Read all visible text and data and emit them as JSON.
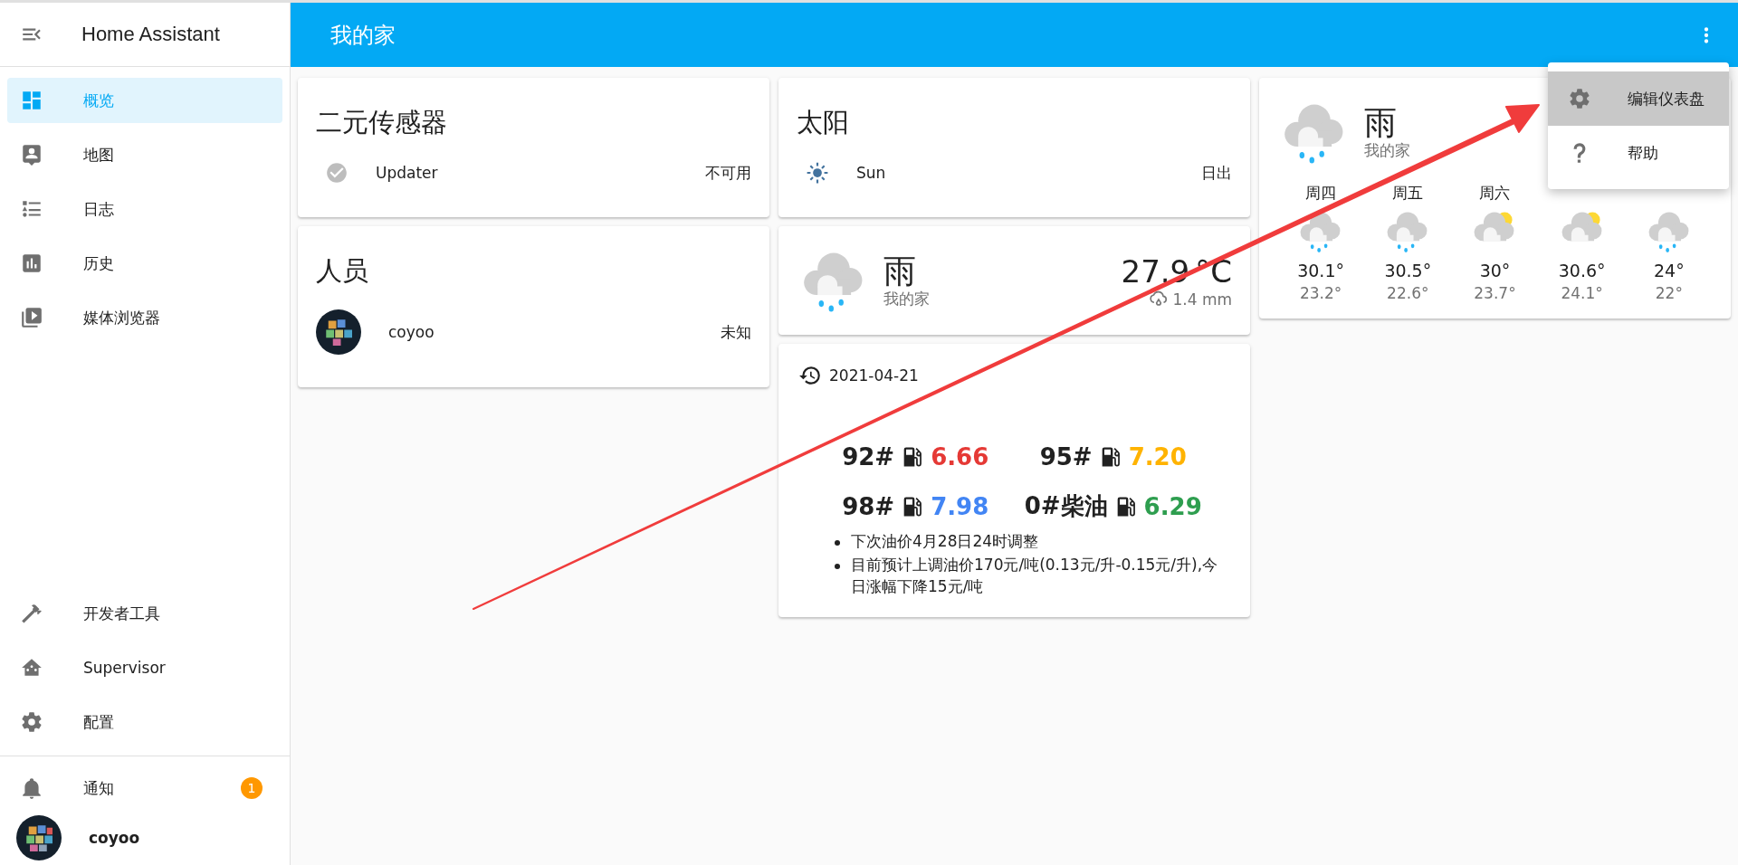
{
  "sidebar": {
    "title": "Home Assistant",
    "items": [
      {
        "label": "概览",
        "selected": true
      },
      {
        "label": "地图",
        "selected": false
      },
      {
        "label": "日志",
        "selected": false
      },
      {
        "label": "历史",
        "selected": false
      },
      {
        "label": "媒体浏览器",
        "selected": false
      }
    ],
    "bottom_items": [
      {
        "label": "开发者工具",
        "selected": false
      },
      {
        "label": "Supervisor",
        "selected": false
      },
      {
        "label": "配置",
        "selected": false
      }
    ],
    "notifications": {
      "label": "通知",
      "count": "1"
    },
    "user": {
      "name": "coyoo"
    }
  },
  "header": {
    "title": "我的家"
  },
  "menu": {
    "items": [
      {
        "label": "编辑仪表盘",
        "selected": true
      },
      {
        "label": "帮助",
        "selected": false
      }
    ]
  },
  "columns": [
    [
      {
        "kind": "entities",
        "title": "二元传感器",
        "rows": [
          {
            "name": "Updater",
            "state": "不可用"
          }
        ]
      },
      {
        "kind": "person",
        "title": "人员",
        "rows": [
          {
            "name": "coyoo",
            "state": "未知"
          }
        ]
      }
    ],
    [
      {
        "kind": "sun",
        "title": "太阳",
        "rows": [
          {
            "name": "Sun",
            "state": "日出"
          }
        ]
      },
      {
        "kind": "weather",
        "current": {
          "kind": "rainy",
          "condition": "雨",
          "location": "我的家"
        },
        "temperature": "27.9",
        "unit": "°C",
        "precipitation": "1.4 mm"
      },
      {
        "kind": "oil",
        "date": "2021-04-21",
        "prices": [
          {
            "label": "92#",
            "price": "6.66",
            "color": "#e53935"
          },
          {
            "label": "95#",
            "price": "7.20",
            "color": "#ffb300"
          },
          {
            "label": "98#",
            "price": "7.98",
            "color": "#4285f4"
          },
          {
            "label": "0#柴油",
            "price": "6.29",
            "color": "#2e9e4f"
          }
        ],
        "notes": [
          "下次油价4月28日24时调整",
          "目前预计上调油价170元/吨(0.13元/升-0.15元/升),今日涨幅下降15元/吨"
        ]
      }
    ],
    [
      {
        "kind": "forecast",
        "current": {
          "kind": "rainy",
          "condition": "雨",
          "location": "我的家"
        },
        "days": [
          {
            "day": "周四",
            "kind": "rainy",
            "high": "30.1°",
            "low": "23.2°"
          },
          {
            "day": "周五",
            "kind": "rainy",
            "high": "30.5°",
            "low": "22.6°"
          },
          {
            "day": "周六",
            "kind": "partlycloudy",
            "high": "30°",
            "low": "23.7°"
          },
          {
            "kind": "partlycloudy",
            "high": "30.6°",
            "low": "24.1°"
          },
          {
            "kind": "rainy",
            "high": "24°",
            "low": "22°"
          }
        ]
      }
    ]
  ]
}
